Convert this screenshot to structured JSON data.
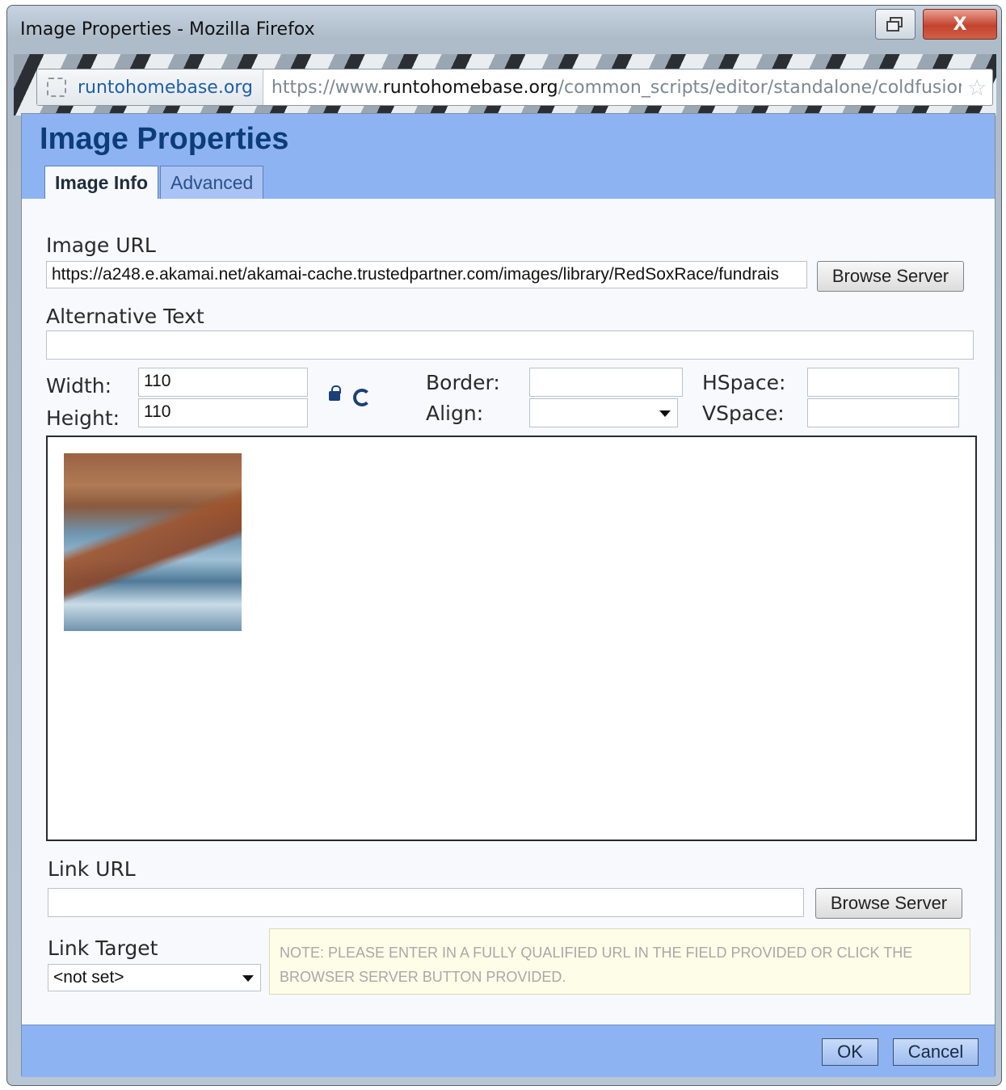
{
  "window": {
    "title": "Image Properties - Mozilla Firefox",
    "close_glyph": "X"
  },
  "addressbar": {
    "site": "runtohomebase.org",
    "url_prefix": "https://www.",
    "url_domain": "runtohomebase.org",
    "url_path": "/common_scripts/editor/standalone/coldfusior"
  },
  "dialog": {
    "title": "Image Properties",
    "tabs": [
      {
        "label": "Image Info",
        "active": true
      },
      {
        "label": "Advanced",
        "active": false
      }
    ],
    "image_url": {
      "label": "Image URL",
      "value": "https://a248.e.akamai.net/akamai-cache.trustedpartner.com/images/library/RedSoxRace/fundrais",
      "browse_label": "Browse Server"
    },
    "alt_text": {
      "label": "Alternative Text",
      "value": ""
    },
    "width": {
      "label": "Width:",
      "value": "110"
    },
    "height": {
      "label": "Height:",
      "value": "110"
    },
    "border": {
      "label": "Border:",
      "value": ""
    },
    "align": {
      "label": "Align:",
      "value": ""
    },
    "hspace": {
      "label": "HSpace:",
      "value": ""
    },
    "vspace": {
      "label": "VSpace:",
      "value": ""
    },
    "link_url": {
      "label": "Link URL",
      "value": "",
      "browse_label": "Browse Server"
    },
    "link_target": {
      "label": "Link Target",
      "value": "<not set>"
    },
    "note": "NOTE: PLEASE ENTER IN A FULLY QUALIFIED URL IN THE FIELD PROVIDED OR CLICK THE BROWSER SERVER BUTTON PROVIDED.",
    "ok_label": "OK",
    "cancel_label": "Cancel"
  }
}
